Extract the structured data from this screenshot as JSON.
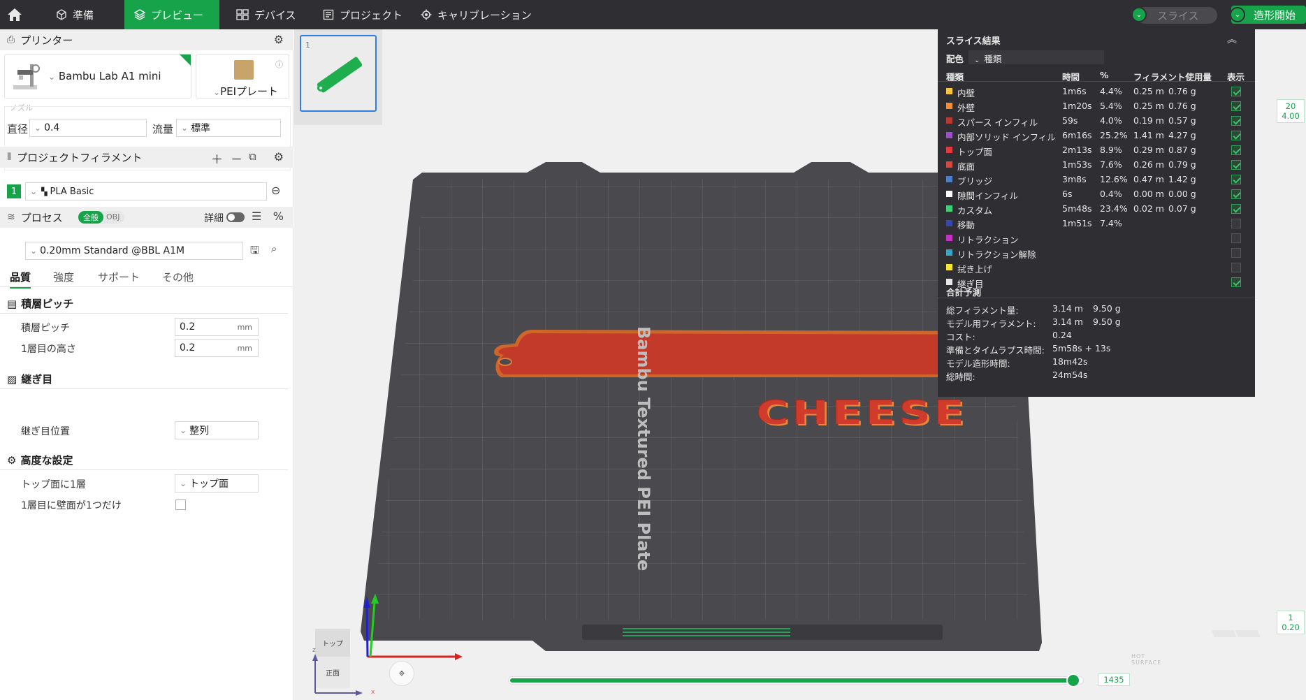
{
  "topbar": {
    "tabs": [
      {
        "label": "準備",
        "icon": "cube-icon"
      },
      {
        "label": "プレビュー",
        "icon": "layers-icon"
      },
      {
        "label": "デバイス",
        "icon": "device-icon"
      },
      {
        "label": "プロジェクト",
        "icon": "project-icon"
      },
      {
        "label": "キャリブレーション",
        "icon": "calibration-icon"
      }
    ],
    "slice_label": "スライス",
    "print_label": "造形開始",
    "accent": "#16a34a"
  },
  "printer": {
    "section_title": "プリンター",
    "name": "Bambu Lab A1 mini",
    "plate": "PEIプレート",
    "nozzle_group": "ノズル",
    "diameter_label": "直径",
    "diameter_value": "0.4",
    "flow_label": "流量",
    "flow_value": "標準"
  },
  "filament": {
    "section_title": "プロジェクトフィラメント",
    "slot": "1",
    "name": "PLA Basic"
  },
  "process": {
    "section_title": "プロセス",
    "toggle_all": "全般",
    "toggle_obj": "OBJ",
    "detail_label": "詳細",
    "preset": "0.20mm Standard @BBL A1M",
    "tabs": [
      "品質",
      "強度",
      "サポート",
      "その他"
    ],
    "groups": {
      "layer": {
        "title": "積層ピッチ",
        "rows": [
          {
            "label": "積層ピッチ",
            "value": "0.2",
            "unit": "mm"
          },
          {
            "label": "1層目の高さ",
            "value": "0.2",
            "unit": "mm"
          }
        ]
      },
      "seam": {
        "title": "継ぎ目",
        "rows": [
          {
            "label": "継ぎ目位置",
            "value": "整列"
          }
        ]
      },
      "advanced": {
        "title": "高度な設定",
        "rows": [
          {
            "label": "トップ面に1層",
            "value": "トップ面"
          },
          {
            "label": "1層目に壁面が1つだけ",
            "value": ""
          }
        ]
      }
    }
  },
  "viewport": {
    "plate_number": "1",
    "bed_label": "Bambu Textured PEI Plate",
    "bed_number": "01",
    "model_text": "CHEESE",
    "view_top": "トップ",
    "view_front": "正面",
    "axis_x": "x",
    "axis_z": "z",
    "slider_value": "1435",
    "top_layer": {
      "a": "20",
      "b": "4.00"
    },
    "bottom_layer": {
      "a": "1",
      "b": "0.20"
    },
    "slider_fraction": 1.0,
    "hot_surface": "HOT SURFACE"
  },
  "slice_result": {
    "title": "スライス結果",
    "color_scheme_label": "配色",
    "color_scheme_value": "種類",
    "headers": [
      "種類",
      "時間",
      "%",
      "フィラメント使用量",
      "表示"
    ],
    "rows": [
      {
        "name": "内壁",
        "color": "#f5c542",
        "time": "1m6s",
        "pct": "4.4%",
        "len": "0.25 m",
        "weight": "0.76 g",
        "visible": true
      },
      {
        "name": "外壁",
        "color": "#f08c3a",
        "time": "1m20s",
        "pct": "5.4%",
        "len": "0.25 m",
        "weight": "0.76 g",
        "visible": true
      },
      {
        "name": "スパース インフィル",
        "color": "#b73a30",
        "time": "59s",
        "pct": "4.0%",
        "len": "0.19 m",
        "weight": "0.57 g",
        "visible": true
      },
      {
        "name": "内部ソリッド インフィル",
        "color": "#9a4fc9",
        "time": "6m16s",
        "pct": "25.2%",
        "len": "1.41 m",
        "weight": "4.27 g",
        "visible": true
      },
      {
        "name": "トップ面",
        "color": "#e0393e",
        "time": "2m13s",
        "pct": "8.9%",
        "len": "0.29 m",
        "weight": "0.87 g",
        "visible": true
      },
      {
        "name": "底面",
        "color": "#d6473f",
        "time": "1m53s",
        "pct": "7.6%",
        "len": "0.26 m",
        "weight": "0.79 g",
        "visible": true
      },
      {
        "name": "ブリッジ",
        "color": "#4d7fc4",
        "time": "3m8s",
        "pct": "12.6%",
        "len": "0.47 m",
        "weight": "1.42 g",
        "visible": true
      },
      {
        "name": "隙間インフィル",
        "color": "#ffffff",
        "time": "6s",
        "pct": "0.4%",
        "len": "0.00 m",
        "weight": "0.00 g",
        "visible": true
      },
      {
        "name": "カスタム",
        "color": "#3fcf7a",
        "time": "5m48s",
        "pct": "23.4%",
        "len": "0.02 m",
        "weight": "0.07 g",
        "visible": true
      },
      {
        "name": "移動",
        "color": "#3848a8",
        "time": "1m51s",
        "pct": "7.4%",
        "len": "",
        "weight": "",
        "visible": false
      },
      {
        "name": "リトラクション",
        "color": "#c432c4",
        "time": "",
        "pct": "",
        "len": "",
        "weight": "",
        "visible": false
      },
      {
        "name": "リトラクション解除",
        "color": "#3aa6c4",
        "time": "",
        "pct": "",
        "len": "",
        "weight": "",
        "visible": false
      },
      {
        "name": "拭き上げ",
        "color": "#f5e633",
        "time": "",
        "pct": "",
        "len": "",
        "weight": "",
        "visible": false
      },
      {
        "name": "継ぎ目",
        "color": "#e8e8e8",
        "time": "",
        "pct": "",
        "len": "",
        "weight": "",
        "visible": true
      }
    ],
    "totals_title": "合計予測",
    "totals": [
      {
        "label": "総フィラメント量:",
        "v1": "3.14 m",
        "v2": "9.50 g"
      },
      {
        "label": "モデル用フィラメント:",
        "v1": "3.14 m",
        "v2": "9.50 g"
      },
      {
        "label": "コスト:",
        "v1": "0.24",
        "v2": ""
      },
      {
        "label": "準備とタイムラプス時間:",
        "v1": "5m58s + 13s",
        "v2": ""
      },
      {
        "label": "モデル造形時間:",
        "v1": "18m42s",
        "v2": ""
      },
      {
        "label": "総時間:",
        "v1": "24m54s",
        "v2": ""
      }
    ]
  }
}
